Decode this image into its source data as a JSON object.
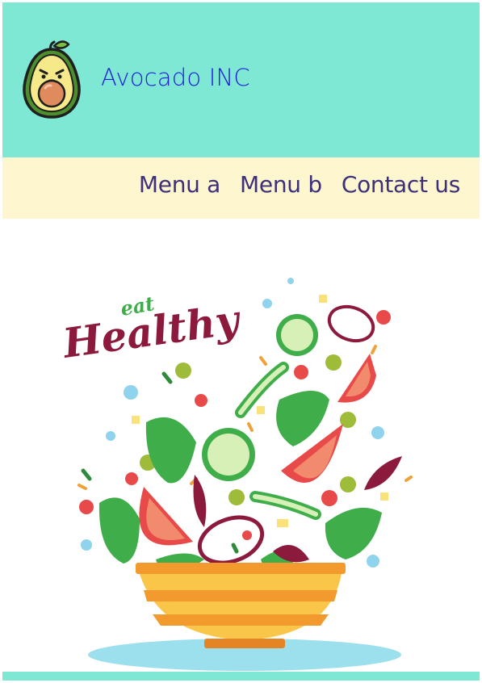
{
  "header": {
    "brand": "Avocado INC",
    "logo_icon": "avocado-icon",
    "background": "#7ee8d4",
    "brand_color": "#1e1edc"
  },
  "nav": {
    "background": "#fdf6cf",
    "items": [
      {
        "label": "Menu a"
      },
      {
        "label": "Menu b"
      },
      {
        "label": "Contact us"
      }
    ]
  },
  "hero": {
    "illustration_icon": "salad-bowl-illustration",
    "caption_small": "eat",
    "caption_large": "Healthy"
  }
}
